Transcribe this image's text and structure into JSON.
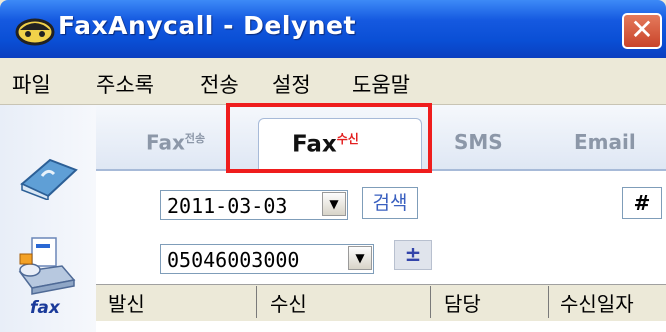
{
  "window": {
    "title": "FaxAnycall - Delynet",
    "close_glyph": "✕"
  },
  "menu": [
    "파일",
    "주소록",
    "전송",
    "설정",
    "도움말"
  ],
  "tabs": {
    "send": {
      "main": "Fax",
      "sup": "전송"
    },
    "receive": {
      "main": "Fax",
      "sup": "수신"
    },
    "sms": "SMS",
    "email": "Email"
  },
  "toolbar": {
    "date_value": "2011-03-03",
    "search_label": "검색",
    "hash_label": "#",
    "number_value": "05046003000",
    "plusminus_label": "±"
  },
  "grid": {
    "columns": [
      "발신",
      "수신",
      "담당",
      "수신일자"
    ]
  },
  "sidebar": {
    "fax_label": "fax"
  },
  "icons": {
    "combo_arrow": "▼"
  },
  "colors": {
    "highlight": "#ef1d1d",
    "title_bar": "#0a4fd5"
  }
}
